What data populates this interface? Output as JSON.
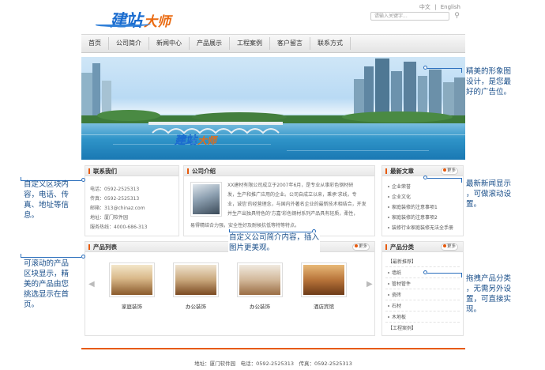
{
  "header": {
    "logo_main": "建站",
    "logo_accent": "大师",
    "lang_zh": "中文",
    "lang_sep": "|",
    "lang_en": "English",
    "search_placeholder": "请输入关键字..."
  },
  "nav": [
    "首页",
    "公司简介",
    "新闻中心",
    "产品展示",
    "工程案例",
    "客户留言",
    "联系方式"
  ],
  "contact": {
    "title": "联系我们",
    "lines": [
      "电话：0592-2525313",
      "传真：0592-2525313",
      "邮箱：313@chinaz.com",
      "地址：厦门软件园",
      "服务热线：4000-686-313"
    ]
  },
  "about": {
    "title": "公司介绍",
    "text": [
      "XX建材有限公司成立于2007年6月，是专业从事彩色钢材研",
      "发，生产和推广应用的企业。公司自成立以来，秉承'求线，专",
      "业，诚信'的经营理念，与国内外著名企业的最新技术相结合，开发",
      "并生产出独具特色的'方嘉'彩色钢材系列产品具有轻质，柔性，",
      "易得精结合力强，安全性好及耐候抗低等特等特点。"
    ]
  },
  "news": {
    "title": "最新文章",
    "more": "更多",
    "items": [
      "企业荣誉",
      "企业文化",
      "家庭装修的注意事项1",
      "家庭装修的注意事项2",
      "装修行业家庭装修无法全手册"
    ]
  },
  "products": {
    "title": "产品列表",
    "more": "更多",
    "items": [
      "家庭装饰",
      "办公装饰",
      "办公装饰",
      "酒店宾馆"
    ]
  },
  "categories": {
    "title": "产品分类",
    "more": "更多",
    "items": [
      "【最新推荐】",
      "墙纸",
      "管材管件",
      "瓷砖",
      "石材",
      "木地板",
      "【工程案例】"
    ]
  },
  "footer": "地址：厦门软件园　电话：0592-2525313　传真：0592-2525313",
  "annotations": {
    "banner": [
      "精美的形象图",
      "设计，是您最",
      "好的广告位。"
    ],
    "news": [
      "最新新闻显示",
      "，可做滚动设",
      "置。"
    ],
    "contact": [
      "自定义区块内",
      "容，电话、传",
      "真、地址等信",
      "息。"
    ],
    "about": [
      "自定义公司简介内容，插入",
      "图片更美观。"
    ],
    "products": [
      "可滚动的产品",
      "区块显示，精",
      "美的产品由您",
      "挑选显示在首",
      "页。"
    ],
    "categories": [
      "拖拽产品分类",
      "，无需另外设",
      "置，可直接实",
      "现。"
    ]
  },
  "colors": {
    "brand_blue": "#1a6ccf",
    "brand_orange": "#ea6b12",
    "annotation_blue": "#1a4f8a"
  }
}
